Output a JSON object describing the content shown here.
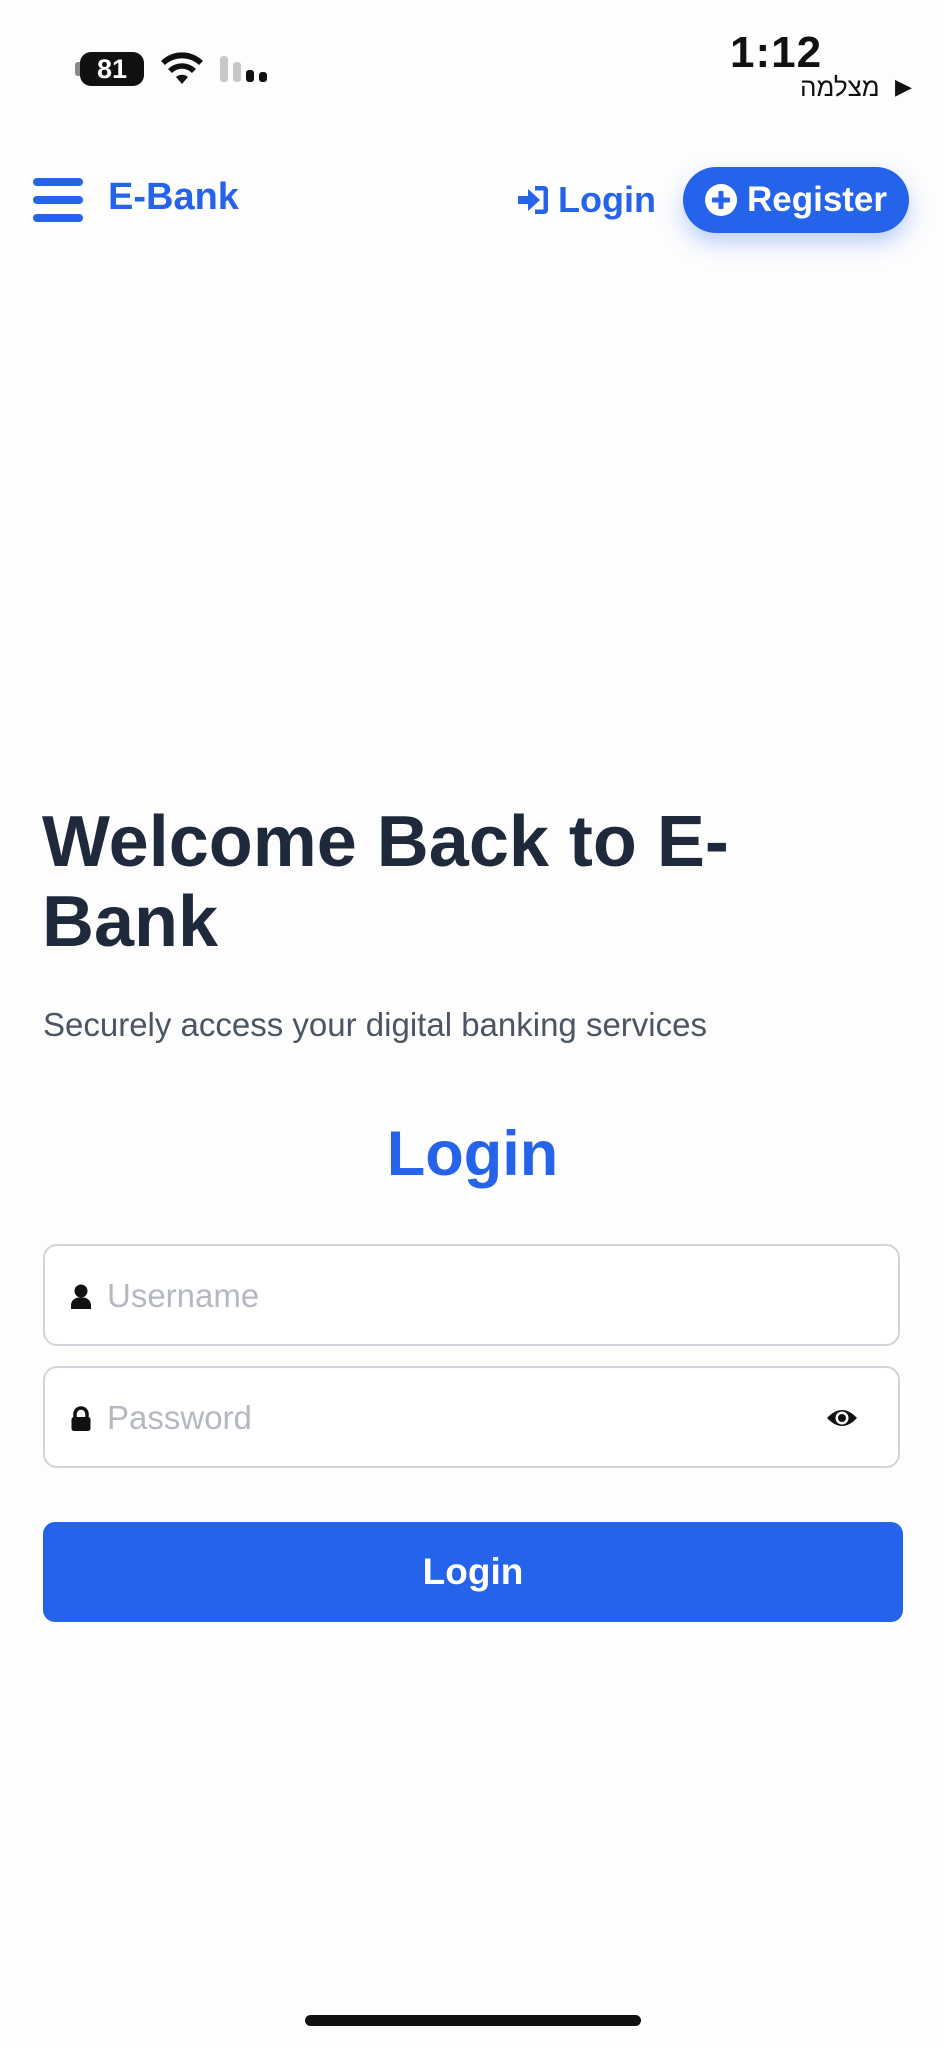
{
  "status_bar": {
    "battery": "81",
    "time": "1:12",
    "back_app": "מצלמה",
    "back_arrow": "▶"
  },
  "nav": {
    "brand": "E-Bank",
    "login_label": "Login",
    "register_label": "Register"
  },
  "hero": {
    "title": "Welcome Back to E-Bank",
    "subtitle": "Securely access your digital banking services"
  },
  "form": {
    "title": "Login",
    "username_placeholder": "Username",
    "password_placeholder": "Password",
    "submit_label": "Login"
  },
  "icons": {
    "menu": "menu-icon",
    "login": "sign-in-icon",
    "register": "plus-circle-icon",
    "username": "user-icon",
    "password": "lock-icon",
    "show_password": "eye-icon"
  },
  "colors": {
    "accent": "#2563eb",
    "heading": "#1e293b",
    "subtitle": "#4b5563",
    "input_border": "#d1d5db",
    "placeholder": "#b4b8c0"
  }
}
